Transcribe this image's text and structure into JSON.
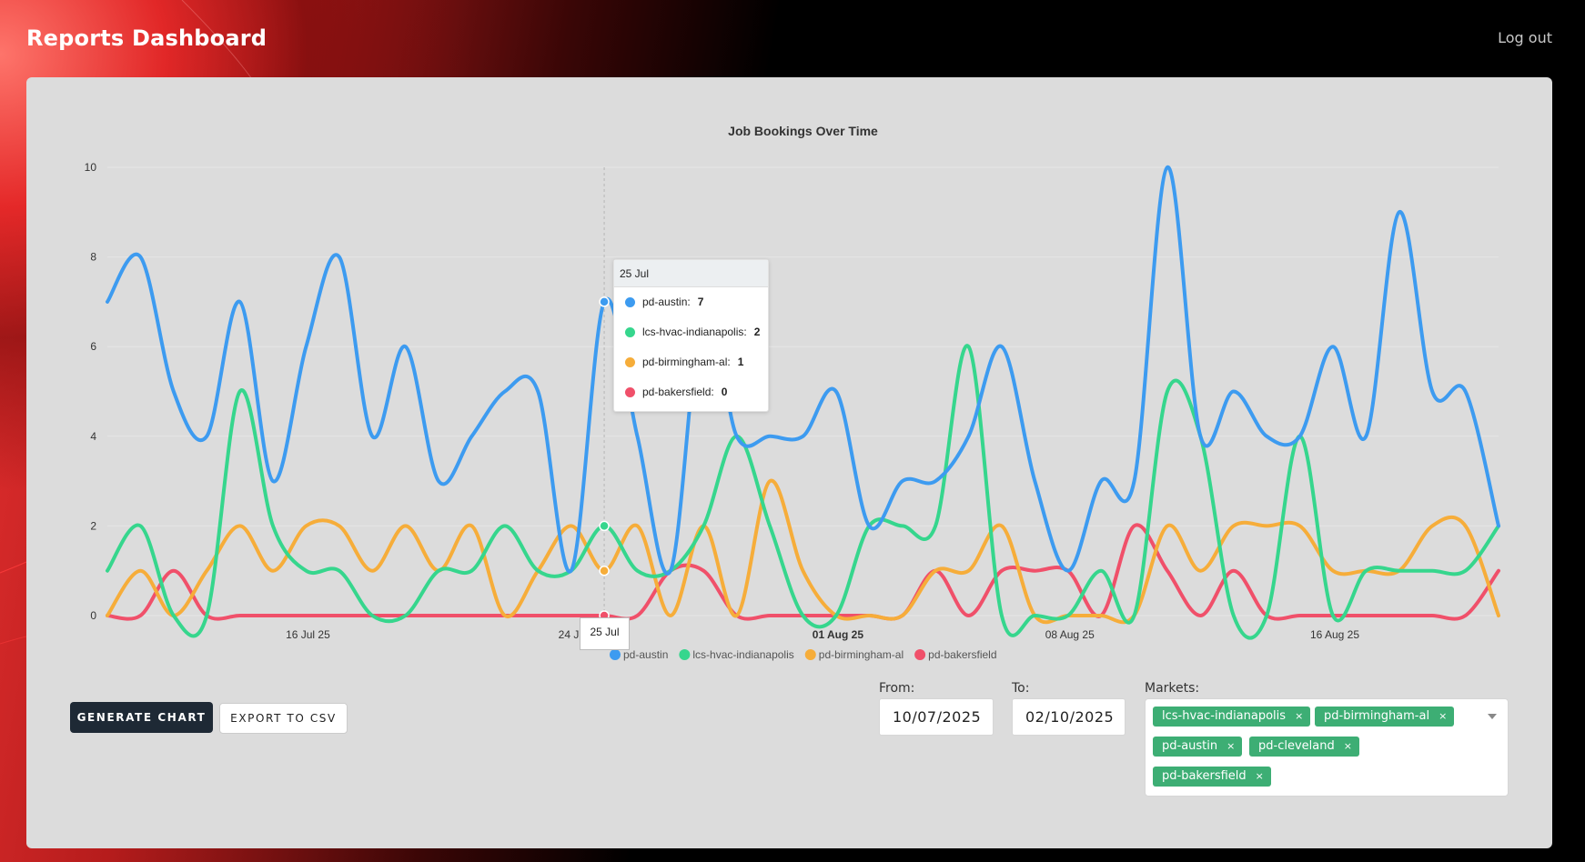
{
  "header": {
    "title": "Reports Dashboard",
    "logout_label": "Log out"
  },
  "colors": {
    "accent_red": "#e53030",
    "pd_austin": "#3d9bf0",
    "lcs_hvac_indianapolis": "#36d68d",
    "pd_birmingham_al": "#f6ad3a",
    "pd_bakersfield": "#f0506a",
    "chip_green": "#3dae74",
    "button_dark": "#1e2935"
  },
  "chart_data": {
    "type": "line",
    "title": "Job Bookings Over Time",
    "xlabel": "",
    "ylabel": "",
    "ylim": [
      0,
      10
    ],
    "yticks": [
      0,
      2,
      4,
      6,
      8,
      10
    ],
    "grid": true,
    "legend_position": "bottom",
    "x_tick_labels": [
      {
        "label": "16 Jul 25",
        "index": 6,
        "bold": false
      },
      {
        "label": "24 Jul",
        "index": 14,
        "bold": false
      },
      {
        "label": "01 Aug 25",
        "index": 22,
        "bold": true
      },
      {
        "label": "08 Aug 25",
        "index": 29,
        "bold": false
      },
      {
        "label": "16 Aug 25",
        "index": 37,
        "bold": false
      }
    ],
    "x_start": "10 Jul 25",
    "x_end": "21 Aug 25",
    "series": [
      {
        "name": "pd-austin",
        "color": "#3d9bf0",
        "values": [
          7,
          8,
          5,
          4,
          7,
          3,
          6,
          8,
          4,
          6,
          3,
          4,
          5,
          5,
          1,
          7,
          4,
          1,
          7,
          4,
          4,
          4,
          5,
          2,
          3,
          3,
          4,
          6,
          3,
          1,
          3,
          3,
          10,
          4,
          5,
          4,
          4,
          6,
          4,
          9,
          5,
          5,
          2
        ]
      },
      {
        "name": "lcs-hvac-indianapolis",
        "color": "#36d68d",
        "values": [
          1,
          2,
          0,
          0,
          5,
          2,
          1,
          1,
          0,
          0,
          1,
          1,
          2,
          1,
          1,
          2,
          1,
          1,
          2,
          4,
          2,
          0,
          0,
          2,
          2,
          2,
          6,
          0,
          0,
          0,
          1,
          0,
          5,
          4,
          0,
          0,
          4,
          0,
          1,
          1,
          1,
          1,
          2
        ]
      },
      {
        "name": "pd-birmingham-al",
        "color": "#f6ad3a",
        "values": [
          0,
          1,
          0,
          1,
          2,
          1,
          2,
          2,
          1,
          2,
          1,
          2,
          0,
          1,
          2,
          1,
          2,
          0,
          2,
          0,
          3,
          1,
          0,
          0,
          0,
          1,
          1,
          2,
          0,
          0,
          0,
          0,
          2,
          1,
          2,
          2,
          2,
          1,
          1,
          1,
          2,
          2,
          0
        ]
      },
      {
        "name": "pd-bakersfield",
        "color": "#f0506a",
        "values": [
          0,
          0,
          1,
          0,
          0,
          0,
          0,
          0,
          0,
          0,
          0,
          0,
          0,
          0,
          0,
          0,
          0,
          1,
          1,
          0,
          0,
          0,
          0,
          0,
          0,
          1,
          0,
          1,
          1,
          1,
          0,
          2,
          1,
          0,
          1,
          0,
          0,
          0,
          0,
          0,
          0,
          0,
          1
        ]
      }
    ],
    "hover": {
      "index": 15,
      "label": "25 Jul",
      "rows": [
        {
          "name": "pd-austin",
          "value": "7",
          "color": "#3d9bf0"
        },
        {
          "name": "lcs-hvac-indianapolis",
          "value": "2",
          "color": "#36d68d"
        },
        {
          "name": "pd-birmingham-al",
          "value": "1",
          "color": "#f6ad3a"
        },
        {
          "name": "pd-bakersfield",
          "value": "0",
          "color": "#f0506a"
        }
      ]
    }
  },
  "controls": {
    "generate_label": "GENERATE CHART",
    "export_label": "EXPORT TO CSV",
    "from_label": "From:",
    "from_value": "10/07/2025",
    "to_label": "To:",
    "to_value": "02/10/2025",
    "markets_label": "Markets:",
    "markets": [
      "lcs-hvac-indianapolis",
      "pd-birmingham-al",
      "pd-austin",
      "pd-cleveland",
      "pd-bakersfield"
    ],
    "chip_remove": "×"
  }
}
